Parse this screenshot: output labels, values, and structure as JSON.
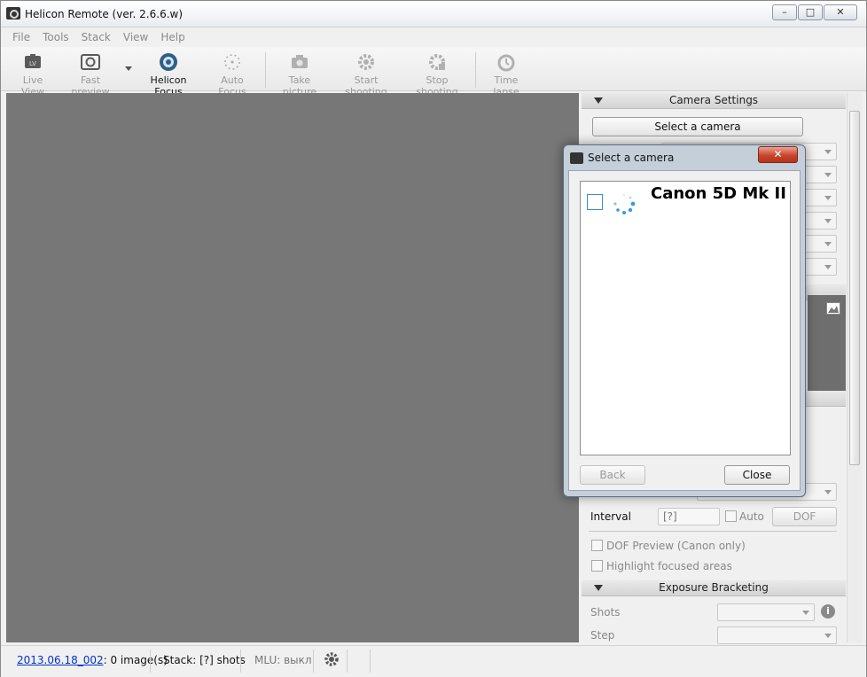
{
  "window": {
    "title": "Helicon Remote (ver. 2.6.6.w)",
    "minimize_glyph": "–",
    "maximize_glyph": "□",
    "close_glyph": "✕"
  },
  "menu": [
    "File",
    "Tools",
    "Stack",
    "View",
    "Help"
  ],
  "toolbar": {
    "live_view": "Live View",
    "fast_preview": "Fast preview",
    "helicon_focus": "Helicon Focus",
    "auto_focus": "Auto Focus",
    "take_picture": "Take picture",
    "start_shooting": "Start shooting",
    "stop_shooting": "Stop shooting",
    "time_lapse": "Time lapse",
    "live_view_badge": "LV"
  },
  "panel": {
    "camera_settings_header": "Camera Settings",
    "select_camera_button": "Select a camera",
    "interval_label": "Interval",
    "interval_value": "[?]",
    "auto_label": "Auto",
    "dof_button": "DOF",
    "dof_preview_label": "DOF Preview (Canon only)",
    "highlight_label": "Highlight focused areas",
    "exposure_header": "Exposure Bracketing",
    "shots_label": "Shots",
    "step_label": "Step",
    "info_glyph": "i"
  },
  "dialog": {
    "title": "Select a camera",
    "close_glyph": "✕",
    "camera_name": "Canon 5D Mk II",
    "back_button": "Back",
    "close_button": "Close"
  },
  "status": {
    "session_link": "2013.06.18_002",
    "images": ": 0 image(s)",
    "stack": "Stack: [?] shots",
    "mlu": "MLU: выкл"
  },
  "colors": {
    "preview_bg": "#777777",
    "link": "#0033cc",
    "spinner": "#3a9ad9",
    "close_red": "#c9452c"
  }
}
